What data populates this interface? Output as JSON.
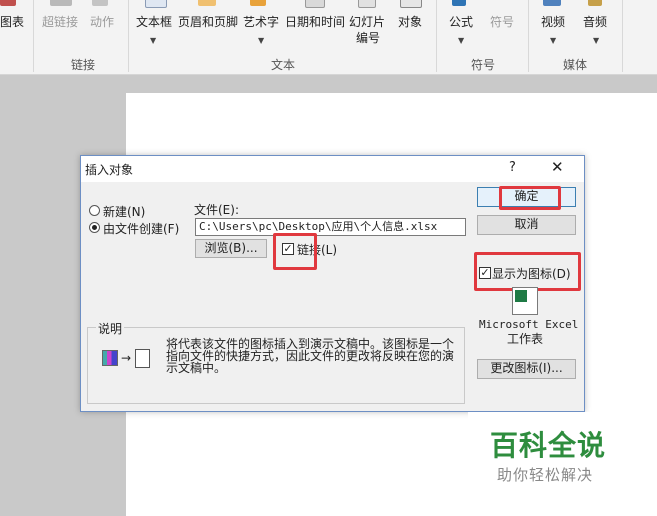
{
  "ribbon": {
    "buttons": {
      "chart": "图表",
      "hyperlink": "超链接",
      "action": "动作",
      "textbox": "文本框",
      "header_footer": "页眉和页脚",
      "wordart": "艺术字",
      "datetime": "日期和时间",
      "slide_number_line1": "幻灯片",
      "slide_number_line2": "编号",
      "object": "对象",
      "equation": "公式",
      "symbol": "符号",
      "video": "视频",
      "audio": "音频"
    },
    "groups": {
      "links": "链接",
      "text": "文本",
      "symbols": "符号",
      "media": "媒体"
    }
  },
  "dialog": {
    "title": "插入对象",
    "help": "?",
    "close": "✕",
    "radio_new": "新建(N)",
    "radio_from_file": "由文件创建(F)",
    "file_label": "文件(E):",
    "file_path": "C:\\Users\\pc\\Desktop\\应用\\个人信息.xlsx",
    "browse_button": "浏览(B)...",
    "link_label": "链接(L)",
    "link_checked": true,
    "ok_button": "确定",
    "cancel_button": "取消",
    "display_as_icon_label": "显示为图标(D)",
    "display_as_icon_checked": true,
    "icon_caption_line1": "Microsoft Excel",
    "icon_caption_line2": "工作表",
    "change_icon_button": "更改图标(I)...",
    "description_label": "说明",
    "description_text": "将代表该文件的图标插入到演示文稿中。该图标是一个指向文件的快捷方式，因此文件的更改将反映在您的演示文稿中。"
  },
  "watermark": {
    "title": "百科全说",
    "subtitle": "助你轻松解决"
  },
  "colors": {
    "highlight_red": "#e0383e",
    "watermark_green": "#2e8d3e",
    "dialog_border": "#6d8fc4"
  }
}
